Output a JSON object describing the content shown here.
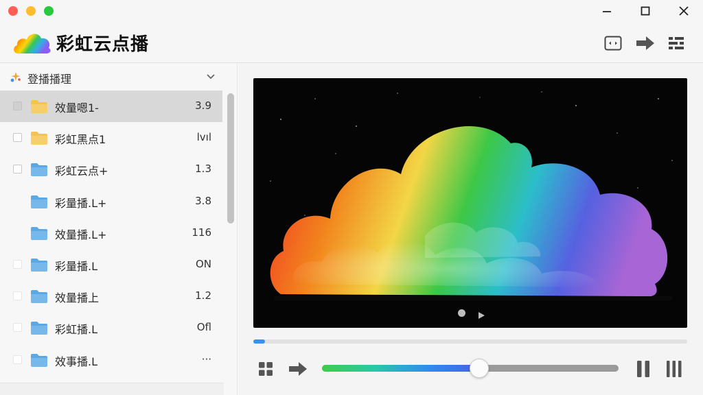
{
  "app": {
    "title": "彩虹云点播",
    "logo_icon": "rainbow-cloud-logo"
  },
  "window_controls": [
    "minimize",
    "maximize",
    "close"
  ],
  "toolbar": {
    "icons": [
      "picture-in-picture-icon",
      "forward-arrow-icon",
      "layout-icon"
    ]
  },
  "sidebar": {
    "header": {
      "title": "登播播理",
      "icon": "sparkle-icon"
    },
    "items": [
      {
        "name": "效量嗯1-",
        "size": "3.9",
        "selected": true,
        "folder_color": "#f5c44c"
      },
      {
        "name": "彩虹黑点1",
        "size": "lvıl",
        "selected": false,
        "folder_color": "#f5c44c"
      },
      {
        "name": "彩虹云点+",
        "size": "1.3",
        "selected": false,
        "folder_color": "#5aa9e6"
      },
      {
        "name": "彩量播.L+",
        "size": "3.8",
        "selected": false,
        "folder_color": "#5aa9e6"
      },
      {
        "name": "效量播.L+",
        "size": "116",
        "selected": false,
        "folder_color": "#5aa9e6"
      },
      {
        "name": "彩量播.L",
        "size": "ON",
        "selected": false,
        "folder_color": "#5aa9e6"
      },
      {
        "name": "效量播上",
        "size": "1.2",
        "selected": false,
        "folder_color": "#5aa9e6"
      },
      {
        "name": "彩虹播.L",
        "size": "Ofl",
        "selected": false,
        "folder_color": "#5aa9e6"
      },
      {
        "name": "效事播.L",
        "size": "···",
        "selected": false,
        "folder_color": "#5aa9e6"
      }
    ]
  },
  "player": {
    "playback_progress": 0.027,
    "volume": 0.53,
    "accent_color": "#3d8ef0"
  }
}
